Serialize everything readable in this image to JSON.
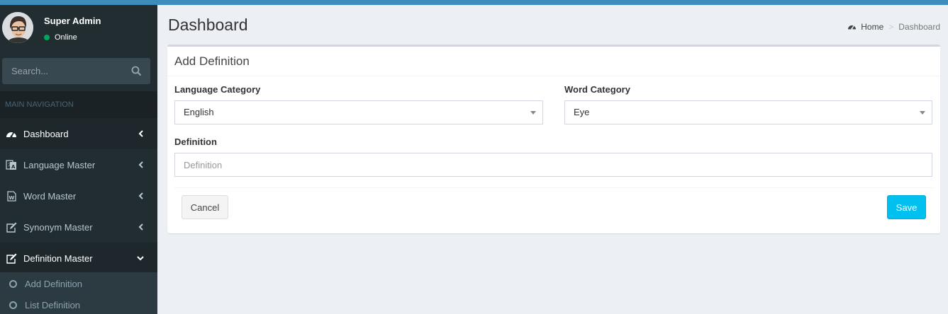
{
  "user": {
    "name": "Super Admin",
    "status": "Online"
  },
  "sidebar": {
    "search_placeholder": "Search...",
    "header": "MAIN NAVIGATION",
    "items": [
      {
        "label": "Dashboard",
        "icon": "dashboard-icon"
      },
      {
        "label": "Language Master",
        "icon": "language-icon"
      },
      {
        "label": "Word Master",
        "icon": "file-word-icon"
      },
      {
        "label": "Synonym Master",
        "icon": "edit-icon"
      },
      {
        "label": "Definition Master",
        "icon": "edit-icon"
      }
    ],
    "sub_items": [
      {
        "label": "Add Definition"
      },
      {
        "label": "List Definition"
      }
    ]
  },
  "page": {
    "title": "Dashboard",
    "breadcrumb": {
      "home": "Home",
      "current": "Dashboard"
    }
  },
  "form": {
    "title": "Add Definition",
    "language_category": {
      "label": "Language Category",
      "value": "English"
    },
    "word_category": {
      "label": "Word Category",
      "value": "Eye"
    },
    "definition": {
      "label": "Definition",
      "placeholder": "Definition"
    },
    "cancel_label": "Cancel",
    "save_label": "Save"
  },
  "colors": {
    "accent": "#3c8dbc",
    "sidebar_bg": "#222d32",
    "save_button": "#00c0ef",
    "status_online": "#00a65a"
  }
}
